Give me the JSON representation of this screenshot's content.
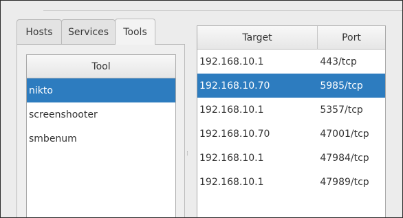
{
  "tabs": [
    {
      "label": "Hosts"
    },
    {
      "label": "Services"
    },
    {
      "label": "Tools"
    }
  ],
  "tools_table": {
    "header": "Tool",
    "rows": [
      "nikto",
      "screenshooter",
      "smbenum"
    ],
    "selected": "nikto"
  },
  "ports_table": {
    "headers": {
      "target": "Target",
      "port": "Port"
    },
    "rows": [
      {
        "target": "192.168.10.1",
        "port": "443/tcp"
      },
      {
        "target": "192.168.10.70",
        "port": "5985/tcp"
      },
      {
        "target": "192.168.10.1",
        "port": "5357/tcp"
      },
      {
        "target": "192.168.10.70",
        "port": "47001/tcp"
      },
      {
        "target": "192.168.10.1",
        "port": "47984/tcp"
      },
      {
        "target": "192.168.10.1",
        "port": "47989/tcp"
      }
    ],
    "selected_row": "192.168.10.70 5985/tcp"
  },
  "colors": {
    "selection": "#2d7cbf",
    "background": "#ececec"
  }
}
